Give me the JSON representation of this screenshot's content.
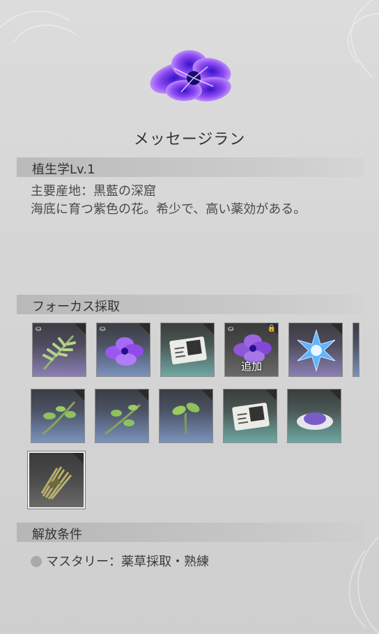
{
  "item": {
    "name": "メッセージラン"
  },
  "info": {
    "header": "植生学Lv.1",
    "lines": [
      "主要産地：黒藍の深窟",
      "海底に育つ紫色の花。希少で、高い薬効がある。"
    ]
  },
  "focus": {
    "header": "フォーカス採取",
    "add_label": "追加",
    "slots": [
      {
        "icon": "grass-herb-icon",
        "bg": "purple"
      },
      {
        "icon": "purple-flower-icon",
        "bg": "blue"
      },
      {
        "icon": "paper-map-icon",
        "bg": "teal"
      },
      {
        "icon": "purple-flower-locked-icon",
        "bg": "gray"
      },
      {
        "icon": "blue-crystal-icon",
        "bg": "purple"
      },
      {
        "icon": "branch-leaves-icon",
        "bg": "blue"
      },
      {
        "icon": "branch-leaves-icon",
        "bg": "blue"
      },
      {
        "icon": "sprout-icon",
        "bg": "blue"
      },
      {
        "icon": "paper-map-icon",
        "bg": "teal"
      },
      {
        "icon": "purple-powder-icon",
        "bg": "teal"
      },
      {
        "icon": "straw-bundle-icon",
        "bg": "gray"
      }
    ]
  },
  "unlock": {
    "header": "解放条件",
    "condition": "マスタリー：薬草採取・熟練"
  }
}
